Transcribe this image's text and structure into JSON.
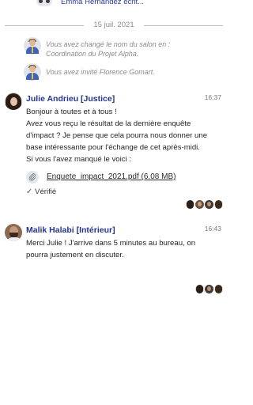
{
  "typing_indicator": {
    "text": "Emma Hernandez écrit..."
  },
  "date_separator": {
    "label": "15 juil. 2021"
  },
  "system_events": [
    {
      "text": "Vous avez changé le nom du salon en : Coordination du Projet Alpha."
    },
    {
      "text": "Vous avez invité Florence Gomart."
    }
  ],
  "messages": [
    {
      "author": "Julie Andrieu [Justice]",
      "time": "16:37",
      "lines": [
        "Bonjour à toutes et à tous !",
        "Avez vous reçu le résultat de la dernière enquête d'impact ? Je pense que cela pourra nous donner une base intéressante pour l'échange de cet après-midi.",
        "Si vous l'avez manqué le voici :"
      ],
      "attachment": {
        "icon": "paperclip-icon",
        "filename": "Enquete_impact_2021.pdf (6.08 MB)"
      },
      "verified_label": "Vérifié"
    },
    {
      "author": "Malik Halabi [Intérieur]",
      "time": "16:43",
      "text": "Merci Julie ! J'arrive dans 5 minutes au bureau, on pourra justement en discuter."
    }
  ],
  "colors": {
    "author": "#23358f",
    "typing": "#2f3b9e",
    "muted": "#8c8c8c"
  }
}
